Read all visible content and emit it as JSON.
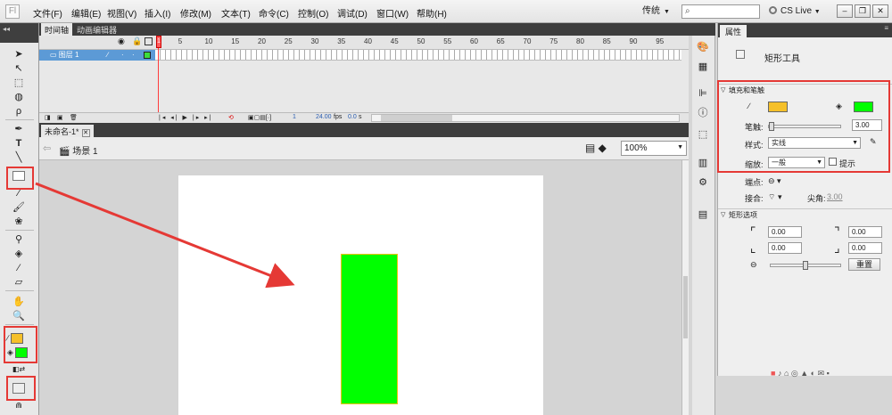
{
  "app": {
    "logo": "Fl"
  },
  "menu": [
    "文件(F)",
    "编辑(E)",
    "视图(V)",
    "插入(I)",
    "修改(M)",
    "文本(T)",
    "命令(C)",
    "控制(O)",
    "调试(D)",
    "窗口(W)",
    "帮助(H)"
  ],
  "topbar": {
    "workspace": "传统",
    "cslive": "CS Live"
  },
  "timeline": {
    "tabs": [
      "时间轴",
      "动画编辑器"
    ],
    "frame_numbers": [
      "1",
      "5",
      "10",
      "15",
      "20",
      "25",
      "30",
      "35",
      "40",
      "45",
      "50",
      "55",
      "60",
      "65",
      "70",
      "75",
      "80",
      "85",
      "90",
      "95"
    ],
    "layer_name": "图层 1",
    "current_frame": "1",
    "fps": "24.00",
    "fps_unit": "fps",
    "time": "0.0",
    "time_unit": "s"
  },
  "document": {
    "tab": "未命名-1*",
    "scene": "场景 1",
    "zoom": "100%"
  },
  "toolbar": {
    "stroke_color": "#f5c02a",
    "fill_color": "#00ff00"
  },
  "properties": {
    "tab": "属性",
    "tool_name": "矩形工具",
    "fill_stroke_section": "填充和笔触",
    "stroke_color": "#f5c02a",
    "fill_color": "#00ff00",
    "stroke_label": "笔触:",
    "stroke_value": "3.00",
    "style_label": "样式:",
    "style_value": "实线",
    "scale_label": "缩放:",
    "scale_value": "一般",
    "hint_label": "提示",
    "cap_label": "端点:",
    "join_label": "接合:",
    "miter_label": "尖角:",
    "miter_value": "3.00",
    "rect_section": "矩形选项",
    "corner_tl": "0.00",
    "corner_tr": "0.00",
    "corner_bl": "0.00",
    "corner_br": "0.00",
    "reset_label": "重置"
  },
  "stage": {
    "rect_fill": "#00ff00",
    "rect_stroke": "#f2c014"
  }
}
